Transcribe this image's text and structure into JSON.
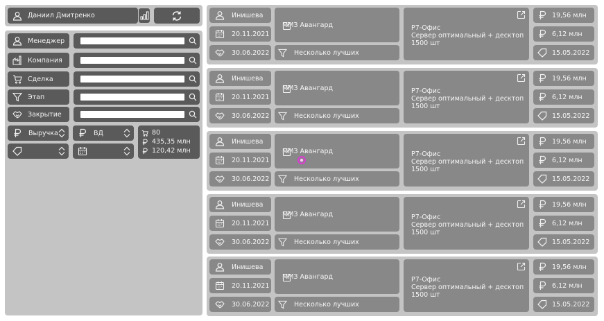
{
  "user": {
    "name": "Даниил Дмитренко"
  },
  "filters": {
    "manager": "Менеджер",
    "company": "Компания",
    "deal": "Сделка",
    "stage": "Этап",
    "closing": "Закрытие",
    "revenue_select": "Выручка",
    "currency_select": "ВД"
  },
  "summary": {
    "count": "80",
    "total": "435,35 млн",
    "secondary": "120,42 млн"
  },
  "cards": [
    {
      "manager": "Инишева",
      "created": "20.11.2021",
      "closing": "30.06.2022",
      "company": "ММЗ Авангард",
      "stage": "Несколько лучших",
      "deal_l1": "Р7-Офис",
      "deal_l2": "Сервер оптимальный + десктоп",
      "deal_l3": "1500 шт",
      "revenue": "19,56 млн",
      "margin": "6,12 млн",
      "date": "15.05.2022"
    },
    {
      "manager": "Инишева",
      "created": "20.11.2021",
      "closing": "30.06.2022",
      "company": "ММЗ Авангард",
      "stage": "Несколько лучших",
      "deal_l1": "Р7-Офис",
      "deal_l2": "Сервер оптимальный + десктоп",
      "deal_l3": "1500 шт",
      "revenue": "19,56 млн",
      "margin": "6,12 млн",
      "date": "15.05.2022"
    },
    {
      "manager": "Инишева",
      "created": "20.11.2021",
      "closing": "30.06.2022",
      "company": "ММЗ Авангард",
      "stage": "Несколько лучших",
      "deal_l1": "Р7-Офис",
      "deal_l2": "Сервер оптимальный + десктоп",
      "deal_l3": "1500 шт",
      "revenue": "19,56 млн",
      "margin": "6,12 млн",
      "date": "15.05.2022"
    },
    {
      "manager": "Инишева",
      "created": "20.11.2021",
      "closing": "30.06.2022",
      "company": "ММЗ Авангард",
      "stage": "Несколько лучших",
      "deal_l1": "Р7-Офис",
      "deal_l2": "Сервер оптимальный + десктоп",
      "deal_l3": "1500 шт",
      "revenue": "19,56 млн",
      "margin": "6,12 млн",
      "date": "15.05.2022"
    },
    {
      "manager": "Инишева",
      "created": "20.11.2021",
      "closing": "30.06.2022",
      "company": "ММЗ Авангард",
      "stage": "Несколько лучших",
      "deal_l1": "Р7-Офис",
      "deal_l2": "Сервер оптимальный + десктоп",
      "deal_l3": "1500 шт",
      "revenue": "19,56 млн",
      "margin": "6,12 млн",
      "date": "15.05.2022"
    }
  ],
  "colors": {
    "chip_dark": "#5a5a5a",
    "box_mid": "#888888",
    "panel": "#c4c4c4",
    "cursor": "#d63fd0"
  }
}
